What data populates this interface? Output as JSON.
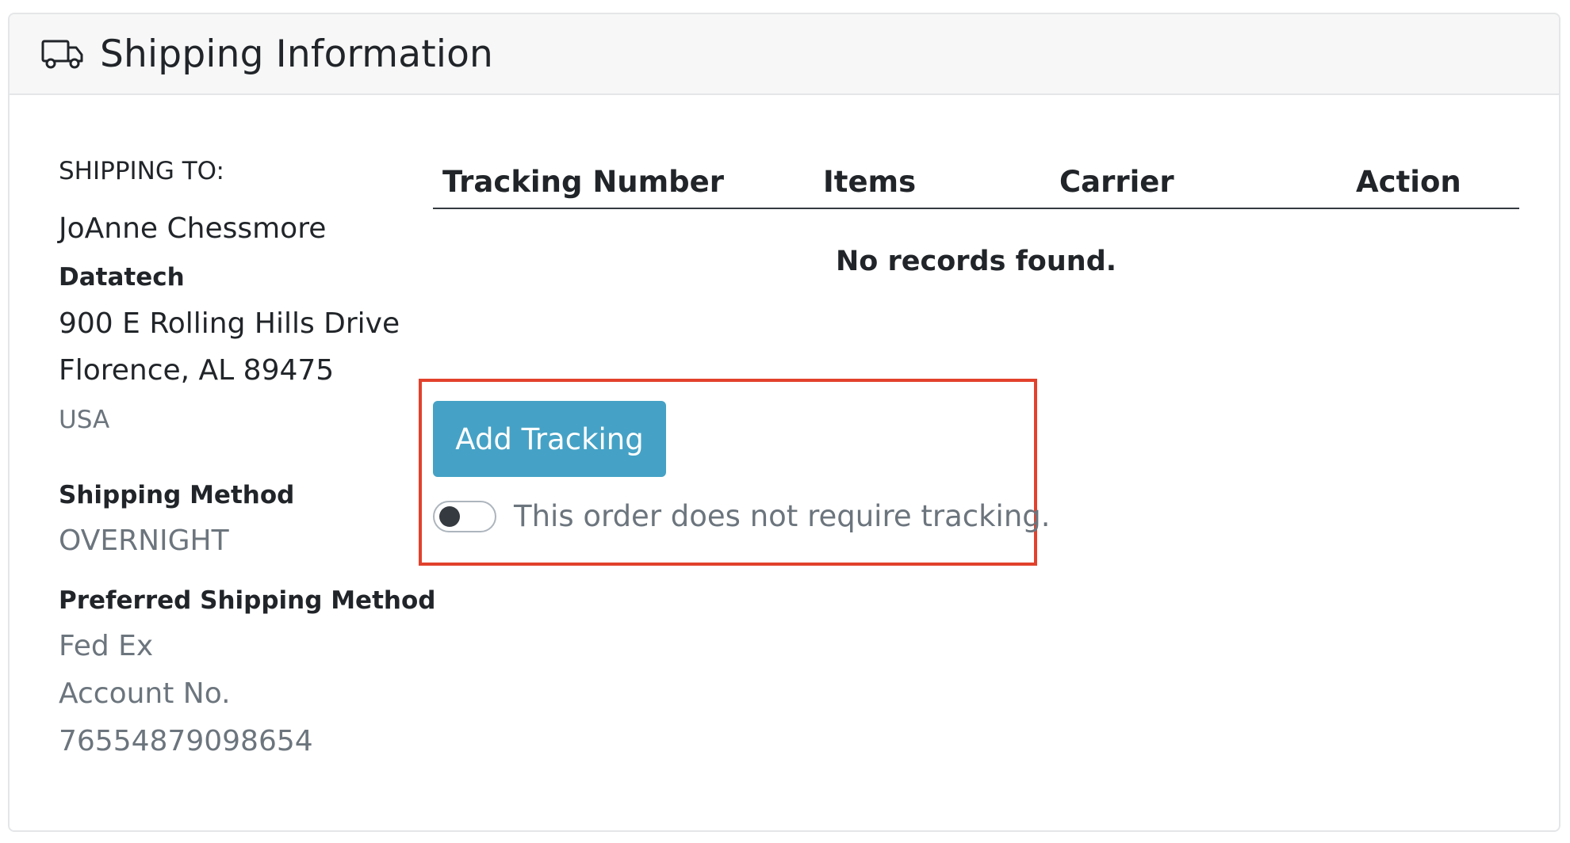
{
  "header": {
    "icon": "truck-icon",
    "title": "Shipping Information"
  },
  "shipping_to": {
    "label": "SHIPPING TO:",
    "name": "JoAnne Chessmore",
    "company": "Datatech",
    "street": "900 E Rolling Hills Drive",
    "city_state_zip": "Florence, AL 89475",
    "country": "USA"
  },
  "shipping_method": {
    "label": "Shipping Method",
    "value": "OVERNIGHT"
  },
  "preferred_shipping_method": {
    "label": "Preferred Shipping Method",
    "carrier": "Fed Ex",
    "account_label": "Account No.",
    "account_number": "76554879098654"
  },
  "tracking_table": {
    "columns": [
      "Tracking Number",
      "Items",
      "Carrier",
      "Action"
    ],
    "empty_message": "No records found."
  },
  "actions": {
    "add_tracking_label": "Add Tracking",
    "no_tracking_toggle_label": "This order does not require tracking.",
    "no_tracking_toggle_on": false
  },
  "colors": {
    "primary_button": "#45a2c6",
    "highlight_border": "#e2412c",
    "muted_text": "#6c757d"
  }
}
